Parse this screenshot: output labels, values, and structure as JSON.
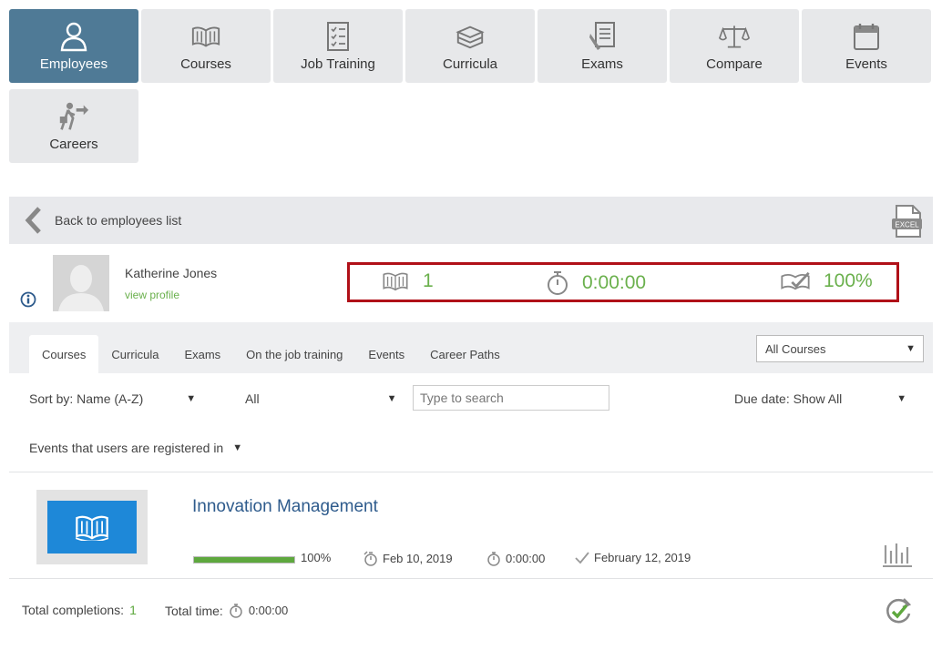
{
  "nav": {
    "tiles": [
      {
        "label": "Employees",
        "icon": "person-icon"
      },
      {
        "label": "Courses",
        "icon": "open-book-icon"
      },
      {
        "label": "Job Training",
        "icon": "checklist-icon"
      },
      {
        "label": "Curricula",
        "icon": "book-stack-icon"
      },
      {
        "label": "Exams",
        "icon": "exam-paper-icon"
      },
      {
        "label": "Compare",
        "icon": "scales-icon"
      },
      {
        "label": "Events",
        "icon": "calendar-icon"
      },
      {
        "label": "Careers",
        "icon": "career-walker-icon"
      }
    ],
    "active_color": "#4f7a96"
  },
  "back": {
    "label": "Back to employees list",
    "excel_text": "EXCEL"
  },
  "profile": {
    "name": "Katherine Jones",
    "link": "view profile",
    "stats": {
      "courses": "1",
      "time": "0:00:00",
      "completion": "100%"
    }
  },
  "tabs": [
    "Courses",
    "Curricula",
    "Exams",
    "On the job training",
    "Events",
    "Career Paths"
  ],
  "filters": {
    "scope_select": "All Courses",
    "sort": "Sort by: Name (A-Z)",
    "status": "All",
    "search_placeholder": "Type to search",
    "due_date": "Due date: Show All",
    "events": "Events that users are registered in"
  },
  "course": {
    "title": "Innovation Management",
    "progress_percent": 100,
    "progress_label": "100%",
    "start_date": "Feb 10, 2019",
    "time": "0:00:00",
    "completed_date": "February 12, 2019"
  },
  "footer": {
    "completions_label": "Total completions:",
    "completions_value": "1",
    "time_label": "Total time:",
    "time_value": "0:00:00"
  },
  "colors": {
    "accent_green": "#6ab04c",
    "highlight_border": "#b01018",
    "title_blue": "#2e5b8c"
  }
}
